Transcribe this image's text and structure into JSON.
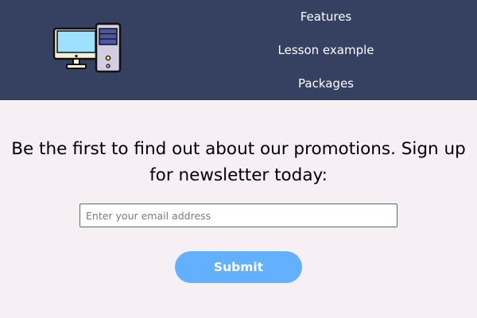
{
  "header": {
    "logo_icon": "desktop-computer-icon",
    "background": "#364061"
  },
  "nav": {
    "items": [
      {
        "label": "Features"
      },
      {
        "label": "Lesson example"
      },
      {
        "label": "Packages"
      }
    ]
  },
  "newsletter": {
    "heading": "Be the first to find out about our promotions. Sign up for newsletter today:",
    "email_placeholder": "Enter your email address",
    "email_value": "",
    "submit_label": "Submit",
    "button_color": "#62b0ff"
  }
}
